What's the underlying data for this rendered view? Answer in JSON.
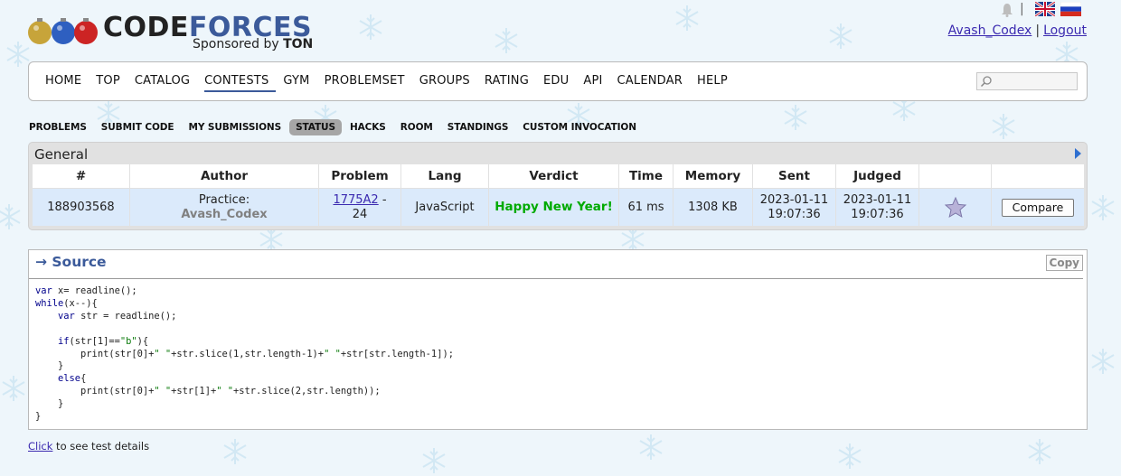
{
  "brand": {
    "name_part1": "CODE",
    "name_part2": "FORCES",
    "sponsor_prefix": "Sponsored by",
    "sponsor_name": "TON"
  },
  "user": {
    "handle": "Avash_Codex",
    "logout": "Logout"
  },
  "main_menu": [
    "HOME",
    "TOP",
    "CATALOG",
    "CONTESTS",
    "GYM",
    "PROBLEMSET",
    "GROUPS",
    "RATING",
    "EDU",
    "API",
    "CALENDAR",
    "HELP"
  ],
  "main_menu_active": "CONTESTS",
  "sub_menu": [
    "PROBLEMS",
    "SUBMIT CODE",
    "MY SUBMISSIONS",
    "STATUS",
    "HACKS",
    "ROOM",
    "STANDINGS",
    "CUSTOM INVOCATION"
  ],
  "sub_menu_active": "STATUS",
  "general": {
    "title": "General",
    "columns": [
      "#",
      "Author",
      "Problem",
      "Lang",
      "Verdict",
      "Time",
      "Memory",
      "Sent",
      "Judged",
      "",
      ""
    ],
    "row": {
      "id": "188903568",
      "author_prefix": "Practice:",
      "author_handle": "Avash_Codex",
      "problem_code": "1775A2",
      "problem_suffix": " -",
      "problem_line2": "24",
      "lang": "JavaScript",
      "verdict": "Happy New Year!",
      "time": "61 ms",
      "memory": "1308 KB",
      "sent_date": "2023-01-11",
      "sent_time": "19:07:36",
      "judged_date": "2023-01-11",
      "judged_time": "19:07:36",
      "compare": "Compare"
    }
  },
  "source": {
    "title": "→ Source",
    "copy": "Copy",
    "code_lines": [
      "var x= readline();",
      "while(x--){",
      "    var str = readline();",
      "",
      "    if(str[1]==\"b\"){",
      "        print(str[0]+\" \"+str.slice(1,str.length-1)+\" \"+str[str.length-1]);",
      "    }",
      "    else{",
      "        print(str[0]+\" \"+str[1]+\" \"+str.slice(2,str.length));",
      "    }",
      "}"
    ]
  },
  "footer": {
    "link": "Click",
    "text": " to see test details"
  },
  "colors": {
    "accent": "#3b5a9a",
    "link": "#3b2ab0",
    "verdict_ok": "#00aa00",
    "row_bg": "#dbeafb"
  },
  "icons": [
    "christmas-balls-icon",
    "bell-icon",
    "uk-flag-icon",
    "ru-flag-icon",
    "search-icon",
    "star-icon",
    "arrow-right-icon"
  ]
}
